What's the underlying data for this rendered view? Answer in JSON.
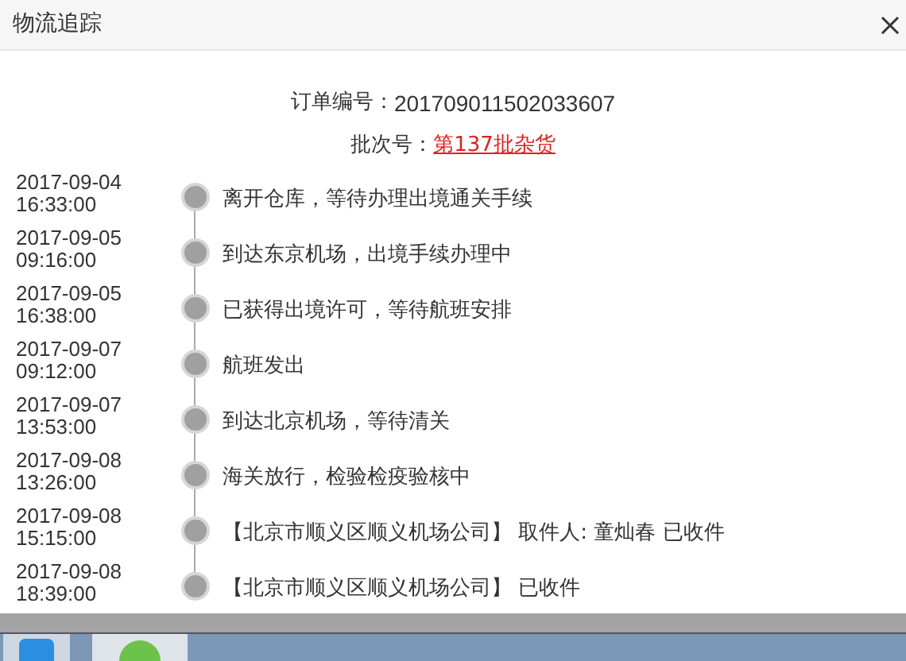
{
  "window": {
    "title": "物流追踪"
  },
  "order": {
    "label": "订单编号：",
    "value": "201709011502033607"
  },
  "batch": {
    "label": "批次号：",
    "link": "第137批杂货"
  },
  "events": [
    {
      "date": "2017-09-04",
      "time": "16:33:00",
      "text": "离开仓库，等待办理出境通关手续"
    },
    {
      "date": "2017-09-05",
      "time": "09:16:00",
      "text": "到达东京机场，出境手续办理中"
    },
    {
      "date": "2017-09-05",
      "time": "16:38:00",
      "text": "已获得出境许可，等待航班安排"
    },
    {
      "date": "2017-09-07",
      "time": "09:12:00",
      "text": "航班发出"
    },
    {
      "date": "2017-09-07",
      "time": "13:53:00",
      "text": "到达北京机场，等待清关"
    },
    {
      "date": "2017-09-08",
      "time": "13:26:00",
      "text": "海关放行，检验检疫验核中"
    },
    {
      "date": "2017-09-08",
      "time": "15:15:00",
      "text": "【北京市顺义区顺义机场公司】 取件人: 童灿春 已收件"
    },
    {
      "date": "2017-09-08",
      "time": "18:39:00",
      "text": "【北京市顺义区顺义机场公司】 已收件"
    }
  ]
}
